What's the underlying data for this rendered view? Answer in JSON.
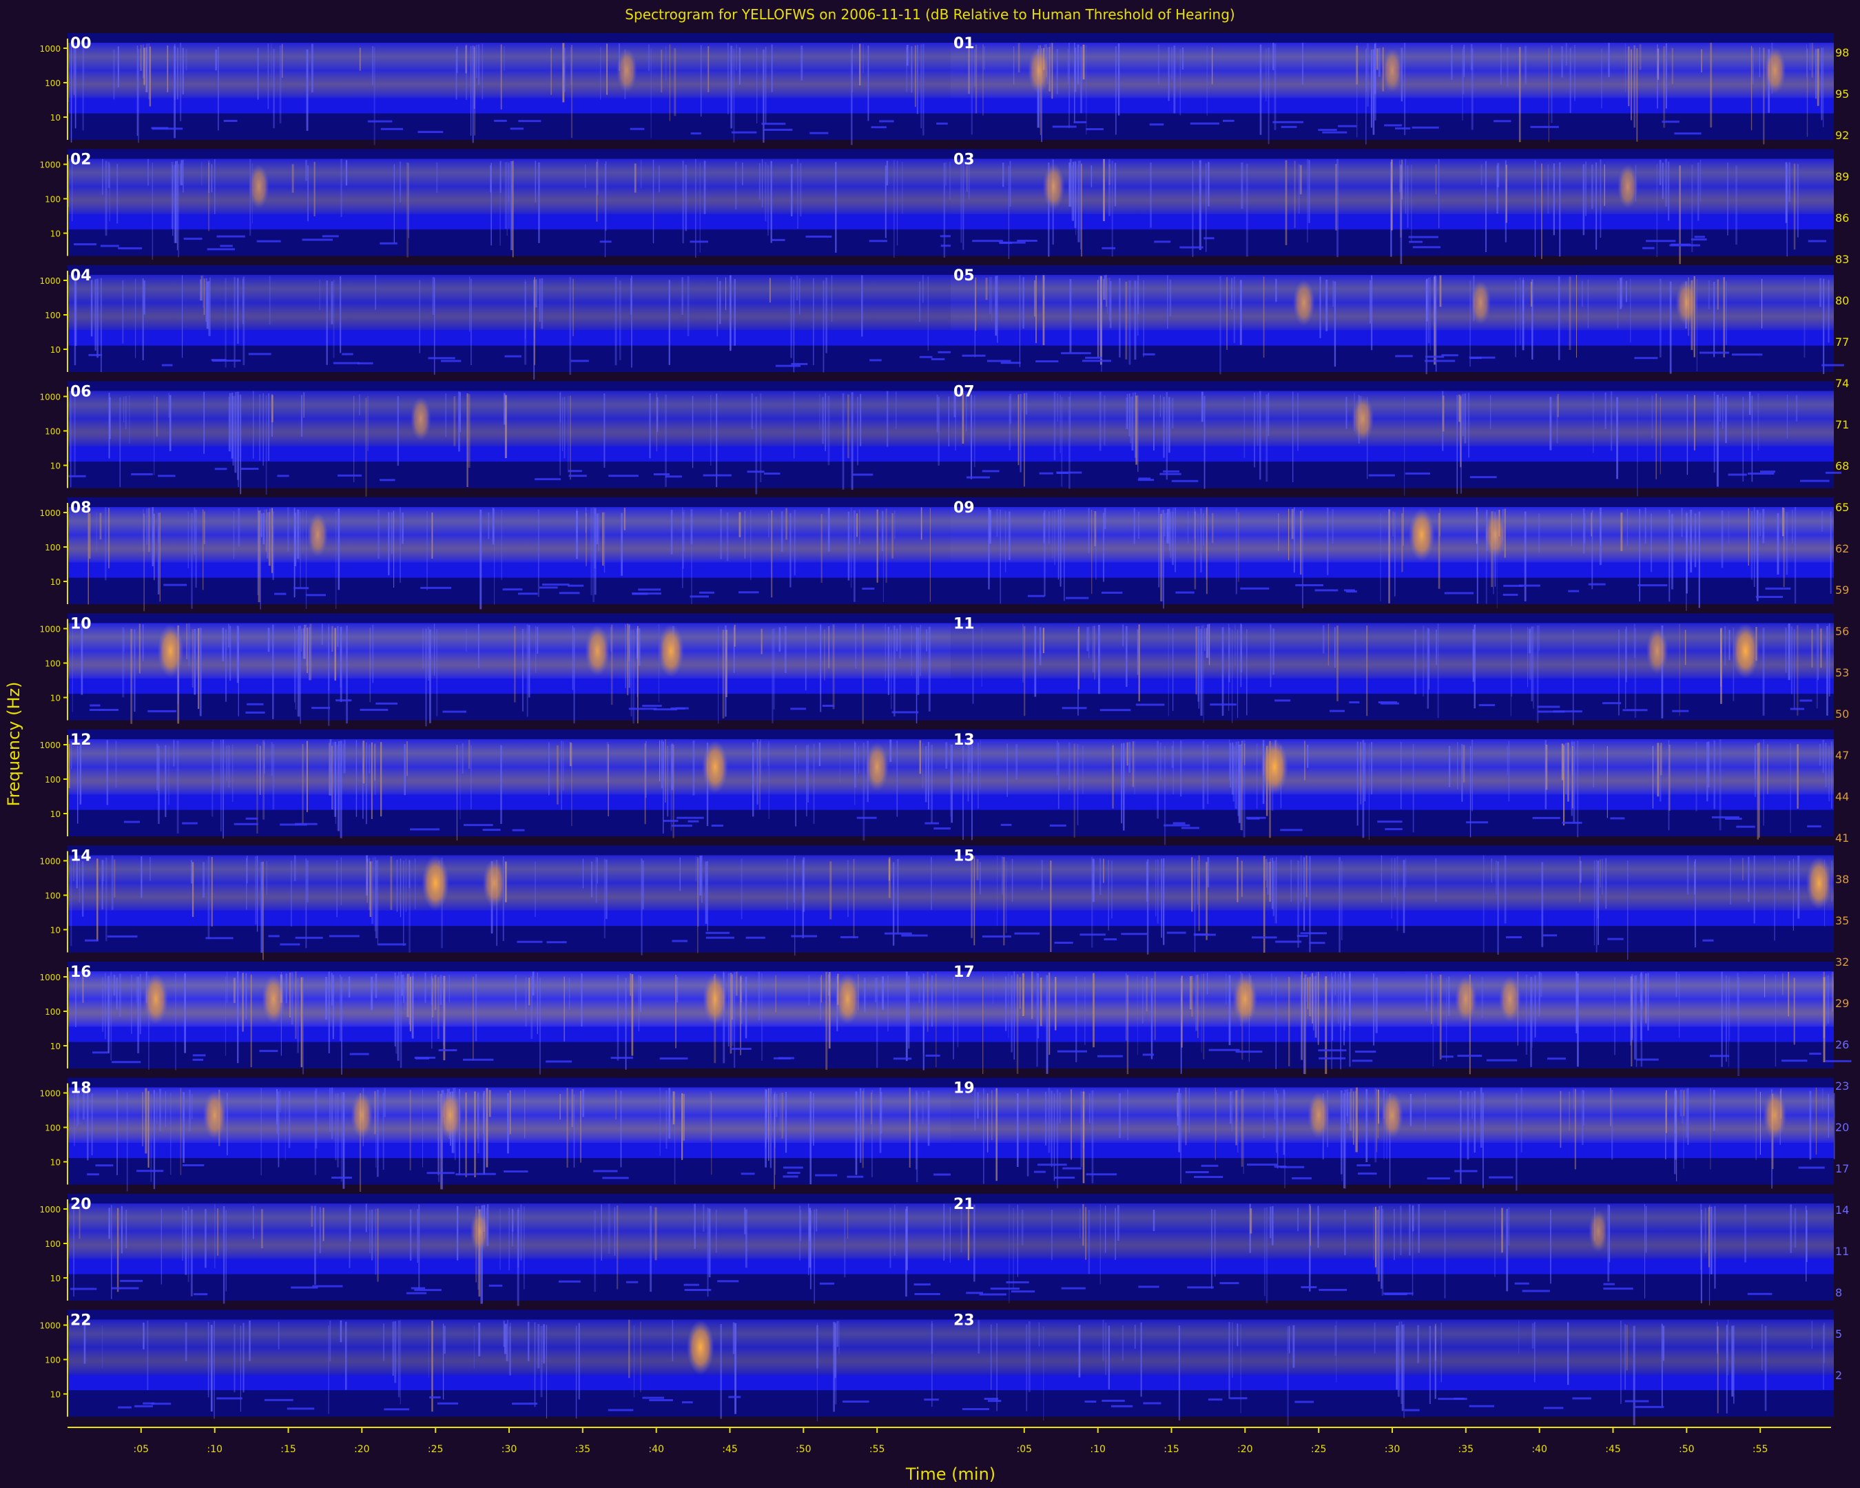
{
  "title": "Spectrogram for YELLOFWS on 2006-11-11 (dB Relative to Human Threshold of Hearing)",
  "colors": {
    "background": "#1a0a2a",
    "axis": "#e8e000",
    "panel_base": "#0a0a7a",
    "band_blue": "#1a1aff",
    "band_haze": "#8c82c8",
    "hotspot": "#e8a040",
    "hour_label": "#ffffff"
  },
  "chart_data": {
    "type": "heatmap",
    "title": "Spectrogram for YELLOFWS on 2006-11-11 (dB Relative to Human Threshold of Hearing)",
    "xlabel": "Time (min)",
    "ylabel": "Frequency (Hz)",
    "hours": [
      "00",
      "01",
      "02",
      "03",
      "04",
      "05",
      "06",
      "07",
      "08",
      "09",
      "10",
      "11",
      "12",
      "13",
      "14",
      "15",
      "16",
      "17",
      "18",
      "19",
      "20",
      "21",
      "22",
      "23"
    ],
    "freq_ticks": [
      "1000",
      "100",
      "10"
    ],
    "time_ticks": [
      ":05",
      ":10",
      ":15",
      ":20",
      ":25",
      ":30",
      ":35",
      ":40",
      ":45",
      ":50",
      ":55"
    ],
    "minutes_per_panel": 60,
    "colorbar_ticks": [
      98,
      95,
      92,
      89,
      86,
      83,
      80,
      77,
      74,
      71,
      68,
      65,
      62,
      59,
      56,
      53,
      50,
      47,
      44,
      41,
      38,
      35,
      32,
      29,
      26,
      23,
      20,
      17,
      14,
      11,
      8,
      5,
      2
    ],
    "hotspots": [
      {
        "hour": 0,
        "minute": 38,
        "strength": 0.5
      },
      {
        "hour": 1,
        "minute": 6,
        "strength": 0.6
      },
      {
        "hour": 1,
        "minute": 30,
        "strength": 0.5
      },
      {
        "hour": 1,
        "minute": 56,
        "strength": 0.6
      },
      {
        "hour": 2,
        "minute": 13,
        "strength": 0.5
      },
      {
        "hour": 3,
        "minute": 7,
        "strength": 0.6
      },
      {
        "hour": 3,
        "minute": 46,
        "strength": 0.5
      },
      {
        "hour": 5,
        "minute": 24,
        "strength": 0.6
      },
      {
        "hour": 5,
        "minute": 36,
        "strength": 0.5
      },
      {
        "hour": 5,
        "minute": 50,
        "strength": 0.6
      },
      {
        "hour": 6,
        "minute": 24,
        "strength": 0.5
      },
      {
        "hour": 7,
        "minute": 28,
        "strength": 0.6
      },
      {
        "hour": 8,
        "minute": 17,
        "strength": 0.5
      },
      {
        "hour": 9,
        "minute": 32,
        "strength": 0.9
      },
      {
        "hour": 9,
        "minute": 37,
        "strength": 0.6
      },
      {
        "hour": 10,
        "minute": 7,
        "strength": 0.9
      },
      {
        "hour": 10,
        "minute": 36,
        "strength": 0.8
      },
      {
        "hour": 10,
        "minute": 41,
        "strength": 0.9
      },
      {
        "hour": 11,
        "minute": 48,
        "strength": 0.6
      },
      {
        "hour": 11,
        "minute": 54,
        "strength": 1.0
      },
      {
        "hour": 12,
        "minute": 44,
        "strength": 0.9
      },
      {
        "hour": 12,
        "minute": 55,
        "strength": 0.7
      },
      {
        "hour": 13,
        "minute": 22,
        "strength": 1.0
      },
      {
        "hour": 14,
        "minute": 25,
        "strength": 1.0
      },
      {
        "hour": 14,
        "minute": 29,
        "strength": 0.7
      },
      {
        "hour": 15,
        "minute": 59,
        "strength": 0.9
      },
      {
        "hour": 16,
        "minute": 6,
        "strength": 0.8
      },
      {
        "hour": 16,
        "minute": 14,
        "strength": 0.7
      },
      {
        "hour": 16,
        "minute": 44,
        "strength": 0.8
      },
      {
        "hour": 16,
        "minute": 53,
        "strength": 0.8
      },
      {
        "hour": 17,
        "minute": 20,
        "strength": 0.8
      },
      {
        "hour": 17,
        "minute": 35,
        "strength": 0.6
      },
      {
        "hour": 17,
        "minute": 38,
        "strength": 0.6
      },
      {
        "hour": 18,
        "minute": 10,
        "strength": 0.7
      },
      {
        "hour": 18,
        "minute": 20,
        "strength": 0.6
      },
      {
        "hour": 18,
        "minute": 26,
        "strength": 0.7
      },
      {
        "hour": 19,
        "minute": 25,
        "strength": 0.6
      },
      {
        "hour": 19,
        "minute": 30,
        "strength": 0.6
      },
      {
        "hour": 19,
        "minute": 56,
        "strength": 0.7
      },
      {
        "hour": 20,
        "minute": 28,
        "strength": 0.4
      },
      {
        "hour": 21,
        "minute": 44,
        "strength": 0.4
      },
      {
        "hour": 22,
        "minute": 43,
        "strength": 1.0
      }
    ],
    "band_intensity": [
      0.55,
      0.7,
      0.45,
      0.5,
      0.35,
      0.55,
      0.4,
      0.5,
      0.7,
      0.8,
      0.75,
      0.55,
      0.7,
      0.75,
      0.5,
      0.5,
      0.95,
      0.9,
      0.85,
      0.75,
      0.45,
      0.3,
      0.2,
      0.2
    ],
    "grid": false,
    "legend": "right"
  }
}
